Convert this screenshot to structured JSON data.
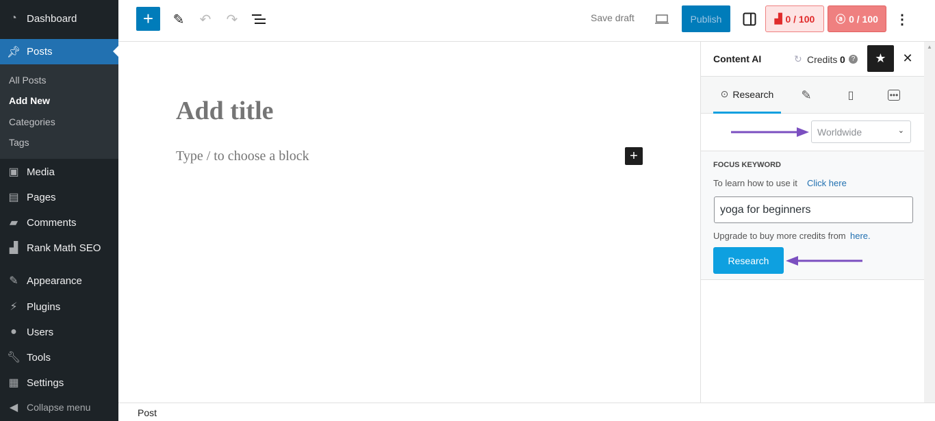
{
  "sidebar": {
    "items": [
      {
        "label": "Dashboard",
        "icon": "dashboard-icon"
      },
      {
        "label": "Posts",
        "icon": "pin-icon",
        "active": true
      },
      {
        "label": "Media",
        "icon": "media-icon"
      },
      {
        "label": "Pages",
        "icon": "pages-icon"
      },
      {
        "label": "Comments",
        "icon": "comment-icon"
      },
      {
        "label": "Rank Math SEO",
        "icon": "rank-math-icon"
      },
      {
        "label": "Appearance",
        "icon": "brush-icon"
      },
      {
        "label": "Plugins",
        "icon": "plugin-icon"
      },
      {
        "label": "Users",
        "icon": "user-icon"
      },
      {
        "label": "Tools",
        "icon": "wrench-icon"
      },
      {
        "label": "Settings",
        "icon": "settings-icon"
      },
      {
        "label": "Collapse menu",
        "icon": "collapse-icon"
      }
    ],
    "posts_sub": [
      "All Posts",
      "Add New",
      "Categories",
      "Tags"
    ]
  },
  "toolbar": {
    "save_draft": "Save draft",
    "publish": "Publish",
    "seo_score": "0 / 100",
    "ai_score": "0 / 100"
  },
  "editor": {
    "title_placeholder": "Add title",
    "block_placeholder": "Type / to choose a block"
  },
  "panel": {
    "title": "Content AI",
    "credits_label": "Credits",
    "credits_value": "0",
    "tabs": [
      {
        "label": "Research",
        "active": true
      }
    ],
    "location": "Worldwide",
    "focus_heading": "FOCUS KEYWORD",
    "learn_text": "To learn how to use it",
    "learn_link": "Click here",
    "keyword": "yoga for beginners",
    "upgrade_text": "Upgrade to buy more credits from",
    "upgrade_link": "here.",
    "research_button": "Research"
  },
  "footer": {
    "breadcrumb": "Post"
  },
  "colors": {
    "accent": "#007cba",
    "sidebar": "#1d2327",
    "active": "#2271b1",
    "research": "#0ea0e0",
    "annotation": "#7b4fc0"
  }
}
